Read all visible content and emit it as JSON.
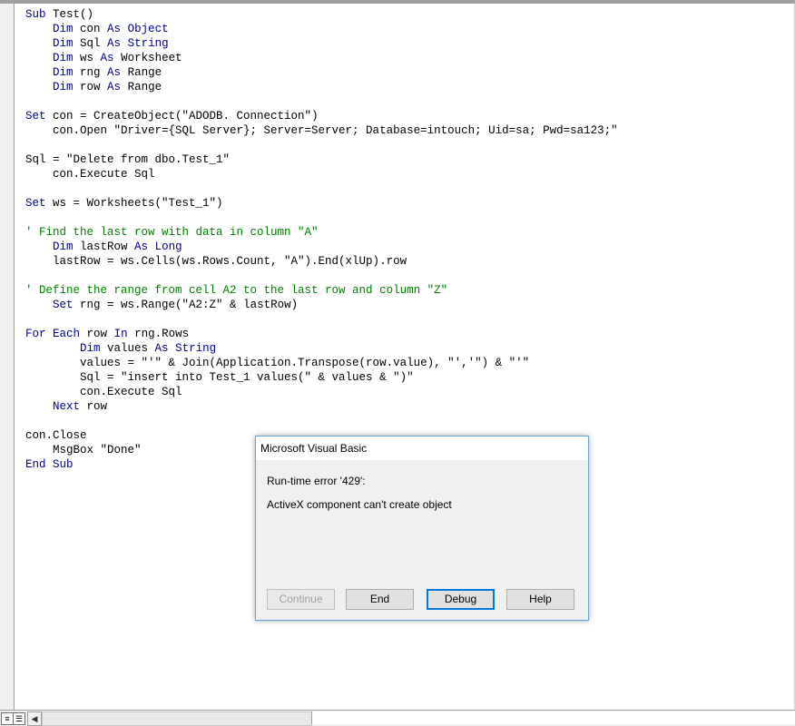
{
  "code_lines": [
    [
      {
        "t": "Sub",
        "k": "kw"
      },
      {
        "t": " Test()"
      }
    ],
    [
      {
        "t": "    "
      },
      {
        "t": "Dim",
        "k": "kw"
      },
      {
        "t": " con "
      },
      {
        "t": "As",
        "k": "kw"
      },
      {
        "t": " "
      },
      {
        "t": "Object",
        "k": "kw"
      }
    ],
    [
      {
        "t": "    "
      },
      {
        "t": "Dim",
        "k": "kw"
      },
      {
        "t": " Sql "
      },
      {
        "t": "As",
        "k": "kw"
      },
      {
        "t": " "
      },
      {
        "t": "String",
        "k": "kw"
      }
    ],
    [
      {
        "t": "    "
      },
      {
        "t": "Dim",
        "k": "kw"
      },
      {
        "t": " ws "
      },
      {
        "t": "As",
        "k": "kw"
      },
      {
        "t": " Worksheet"
      }
    ],
    [
      {
        "t": "    "
      },
      {
        "t": "Dim",
        "k": "kw"
      },
      {
        "t": " rng "
      },
      {
        "t": "As",
        "k": "kw"
      },
      {
        "t": " Range"
      }
    ],
    [
      {
        "t": "    "
      },
      {
        "t": "Dim",
        "k": "kw"
      },
      {
        "t": " row "
      },
      {
        "t": "As",
        "k": "kw"
      },
      {
        "t": " Range"
      }
    ],
    [],
    [
      {
        "t": "Set",
        "k": "kw"
      },
      {
        "t": " con = CreateObject(\"ADODB. Connection\")"
      }
    ],
    [
      {
        "t": "    con.Open \"Driver={SQL Server}; Server=Server; Database=intouch; Uid=sa; Pwd=sa123;\""
      }
    ],
    [],
    [
      {
        "t": "Sql = \"Delete from dbo.Test_1\""
      }
    ],
    [
      {
        "t": "    con.Execute Sql"
      }
    ],
    [],
    [
      {
        "t": "Set",
        "k": "kw"
      },
      {
        "t": " ws = Worksheets(\"Test_1\")"
      }
    ],
    [],
    [
      {
        "t": "' Find the last row with data in column \"A\"",
        "k": "cm"
      }
    ],
    [
      {
        "t": "    "
      },
      {
        "t": "Dim",
        "k": "kw"
      },
      {
        "t": " lastRow "
      },
      {
        "t": "As",
        "k": "kw"
      },
      {
        "t": " "
      },
      {
        "t": "Long",
        "k": "kw"
      }
    ],
    [
      {
        "t": "    lastRow = ws.Cells(ws.Rows.Count, \"A\").End(xlUp).row"
      }
    ],
    [],
    [
      {
        "t": "' Define the range from cell A2 to the last row and column \"Z\"",
        "k": "cm"
      }
    ],
    [
      {
        "t": "    "
      },
      {
        "t": "Set",
        "k": "kw"
      },
      {
        "t": " rng = ws.Range(\"A2:Z\" & lastRow)"
      }
    ],
    [],
    [
      {
        "t": "For",
        "k": "kw"
      },
      {
        "t": " "
      },
      {
        "t": "Each",
        "k": "kw"
      },
      {
        "t": " row "
      },
      {
        "t": "In",
        "k": "kw"
      },
      {
        "t": " rng.Rows"
      }
    ],
    [
      {
        "t": "        "
      },
      {
        "t": "Dim",
        "k": "kw"
      },
      {
        "t": " values "
      },
      {
        "t": "As",
        "k": "kw"
      },
      {
        "t": " "
      },
      {
        "t": "String",
        "k": "kw"
      }
    ],
    [
      {
        "t": "        values = \"'\" & Join(Application.Transpose(row.value), \"','\") & \"'\""
      }
    ],
    [
      {
        "t": "        Sql = \"insert into Test_1 values(\" & values & \")\""
      }
    ],
    [
      {
        "t": "        con.Execute Sql"
      }
    ],
    [
      {
        "t": "    "
      },
      {
        "t": "Next",
        "k": "kw"
      },
      {
        "t": " row"
      }
    ],
    [],
    [
      {
        "t": "con.Close"
      }
    ],
    [
      {
        "t": "    MsgBox \"Done\""
      }
    ],
    [
      {
        "t": "End",
        "k": "kw"
      },
      {
        "t": " "
      },
      {
        "t": "Sub",
        "k": "kw"
      }
    ]
  ],
  "dialog": {
    "title": "Microsoft Visual Basic",
    "error_line": "Run-time error '429':",
    "message": "ActiveX component can't create object",
    "buttons": {
      "continue": "Continue",
      "end": "End",
      "debug": "Debug",
      "help": "Help"
    }
  },
  "icons": {
    "procedure_view": "procedure-view-icon",
    "full_module_view": "full-module-view-icon",
    "scroll_left": "scroll-left-arrow-icon"
  },
  "colors": {
    "keyword": "#00008b",
    "comment": "#008000",
    "default_button_border": "#0078d7"
  }
}
